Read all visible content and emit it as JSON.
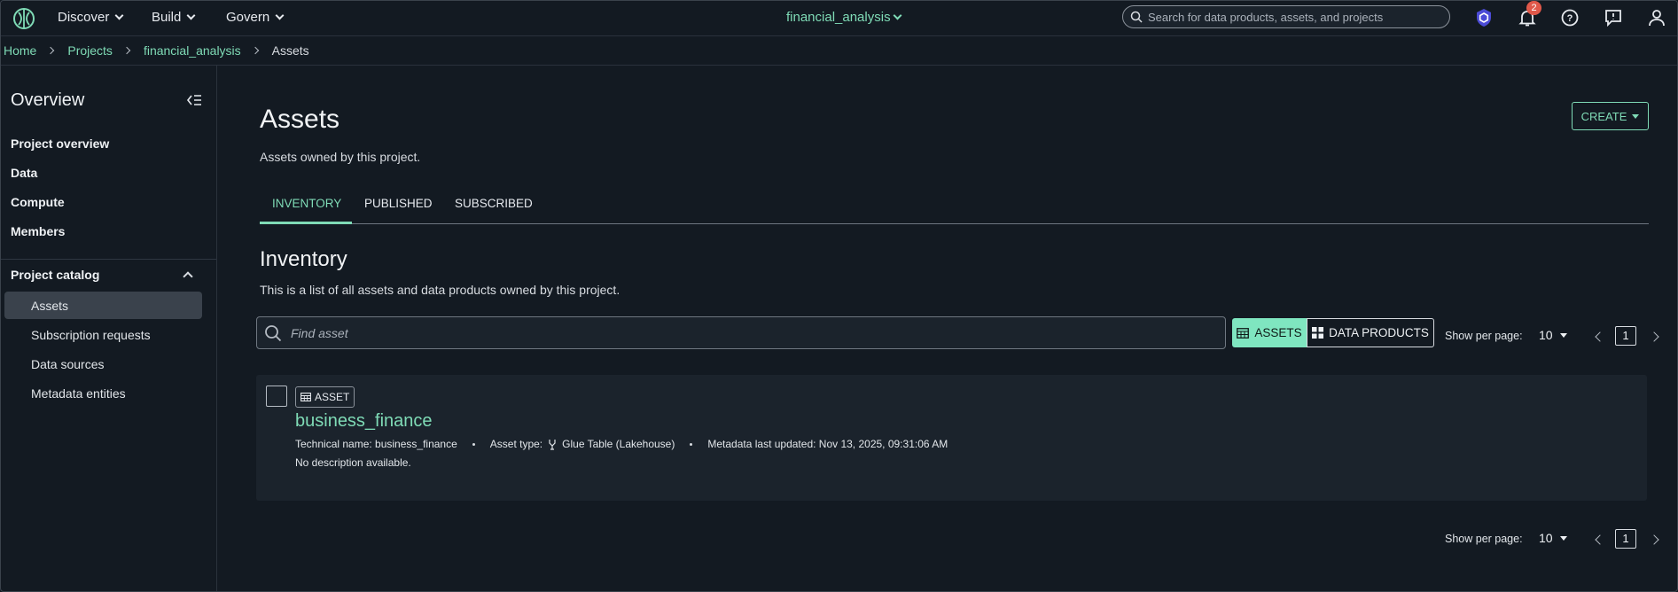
{
  "topnav": {
    "menus": [
      "Discover",
      "Build",
      "Govern"
    ],
    "project_selector": "financial_analysis",
    "search_placeholder": "Search for data products, assets, and projects",
    "notification_count": "2"
  },
  "breadcrumb": {
    "items": [
      "Home",
      "Projects",
      "financial_analysis"
    ],
    "current": "Assets"
  },
  "sidebar": {
    "title": "Overview",
    "items": [
      "Project overview",
      "Data",
      "Compute",
      "Members"
    ],
    "catalog_title": "Project catalog",
    "catalog_items": [
      "Assets",
      "Subscription requests",
      "Data sources",
      "Metadata entities"
    ]
  },
  "main": {
    "title": "Assets",
    "subtitle": "Assets owned by this project.",
    "create_label": "CREATE",
    "tabs": [
      "INVENTORY",
      "PUBLISHED",
      "SUBSCRIBED"
    ],
    "inventory_title": "Inventory",
    "inventory_subtitle": "This is a list of all assets and data products owned by this project.",
    "find_placeholder": "Find asset",
    "toggle_assets": "ASSETS",
    "toggle_data_products": "DATA PRODUCTS",
    "per_page_label": "Show per page:",
    "per_page_value": "10",
    "page_number": "1"
  },
  "asset": {
    "tag": "ASSET",
    "name": "business_finance",
    "technical_name": "Technical name: business_finance",
    "asset_type_label": "Asset type:",
    "asset_type": "Glue Table (Lakehouse)",
    "metadata_updated": "Metadata last updated: Nov 13, 2025, 09:31:06 AM",
    "description": "No description available."
  },
  "colors": {
    "accent": "#7fdbb6",
    "background": "#131a22",
    "badge": "#e0584a"
  },
  "icons": [
    "logo-icon",
    "search-icon",
    "shield-icon",
    "bell-icon",
    "help-icon",
    "feedback-icon",
    "user-icon",
    "collapse-icon",
    "table-icon",
    "grid-icon",
    "glue-icon"
  ]
}
